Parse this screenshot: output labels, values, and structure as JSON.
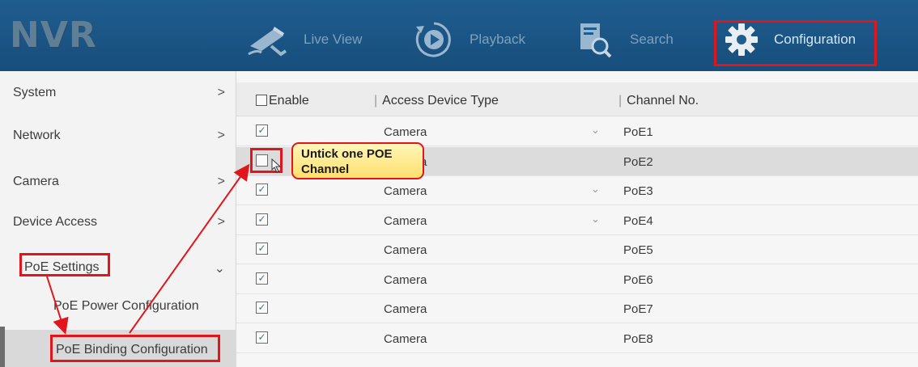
{
  "header": {
    "logo": "NVR",
    "nav": [
      {
        "label": "Live View",
        "icon": "camera-icon"
      },
      {
        "label": "Playback",
        "icon": "play-icon"
      },
      {
        "label": "Search",
        "icon": "search-icon"
      },
      {
        "label": "Configuration",
        "icon": "gear-icon",
        "active": true
      }
    ]
  },
  "sidebar": {
    "items": [
      {
        "label": "System",
        "arrow": ">"
      },
      {
        "label": "Network",
        "arrow": ">"
      },
      {
        "label": "Camera",
        "arrow": ">"
      },
      {
        "label": "Device Access",
        "arrow": ">"
      },
      {
        "label": "PoE Settings",
        "arrow": "⌄"
      }
    ],
    "subitems": [
      {
        "label": "PoE Power Configuration"
      },
      {
        "label": "PoE Binding Configuration",
        "selected": true
      }
    ]
  },
  "table": {
    "headers": {
      "enable": "Enable",
      "type": "Access Device Type",
      "channel": "Channel No."
    },
    "separator": "|",
    "rows": [
      {
        "checked": true,
        "type": "Camera",
        "dropdown": true,
        "channel": "PoE1"
      },
      {
        "checked": false,
        "type": "Camera",
        "dropdown": false,
        "channel": "PoE2",
        "selected": true
      },
      {
        "checked": true,
        "type": "Camera",
        "dropdown": true,
        "channel": "PoE3"
      },
      {
        "checked": true,
        "type": "Camera",
        "dropdown": true,
        "channel": "PoE4"
      },
      {
        "checked": true,
        "type": "Camera",
        "dropdown": false,
        "channel": "PoE5"
      },
      {
        "checked": true,
        "type": "Camera",
        "dropdown": false,
        "channel": "PoE6"
      },
      {
        "checked": true,
        "type": "Camera",
        "dropdown": false,
        "channel": "PoE7"
      },
      {
        "checked": true,
        "type": "Camera",
        "dropdown": false,
        "channel": "PoE8"
      }
    ]
  },
  "callout": {
    "line1": "Untick one POE",
    "line2": "Channel"
  },
  "colors": {
    "header": "#1f5d8f",
    "annotation": "#e0161c",
    "callout": "#ffe06e"
  }
}
